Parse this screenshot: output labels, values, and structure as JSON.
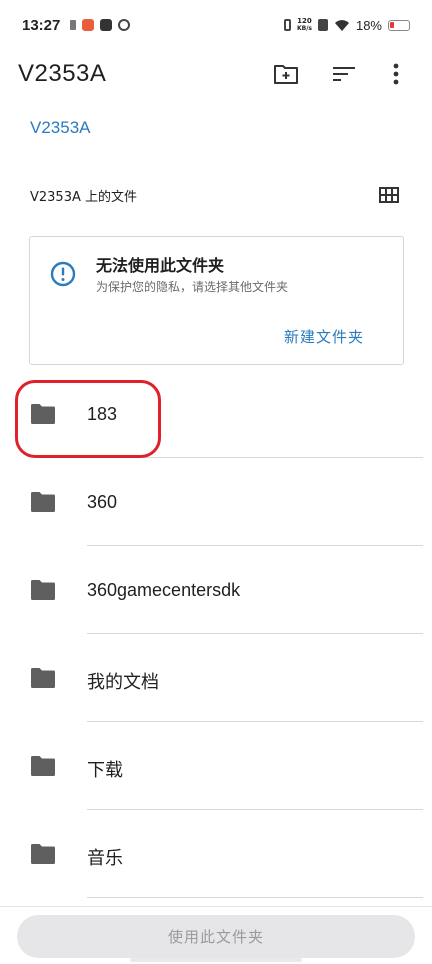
{
  "status_bar": {
    "time": "13:27",
    "net_speed_top": "120",
    "net_speed_bottom": "KB/s",
    "battery_text": "18%"
  },
  "app_bar": {
    "title": "V2353A",
    "icons": [
      "new-folder-icon",
      "sort-icon",
      "more-vert-icon"
    ]
  },
  "breadcrumb": {
    "current": "V2353A"
  },
  "section": {
    "title": "V2353A 上的文件",
    "view_toggle_icon": "grid-view-icon"
  },
  "warning_card": {
    "icon": "info-icon",
    "title": "无法使用此文件夹",
    "subtitle": "为保护您的隐私，请选择其他文件夹",
    "action_label": "新建文件夹"
  },
  "folders": [
    {
      "name": "183"
    },
    {
      "name": "360"
    },
    {
      "name": "360gamecentersdk"
    },
    {
      "name": "我的文档"
    },
    {
      "name": "下载"
    },
    {
      "name": "音乐"
    }
  ],
  "bottom": {
    "use_button_label": "使用此文件夹"
  },
  "colors": {
    "accent": "#2a7bbf",
    "highlight": "#e0202b",
    "disabled_button_bg": "#e6e6e9",
    "disabled_button_text": "#9a9a9f"
  }
}
